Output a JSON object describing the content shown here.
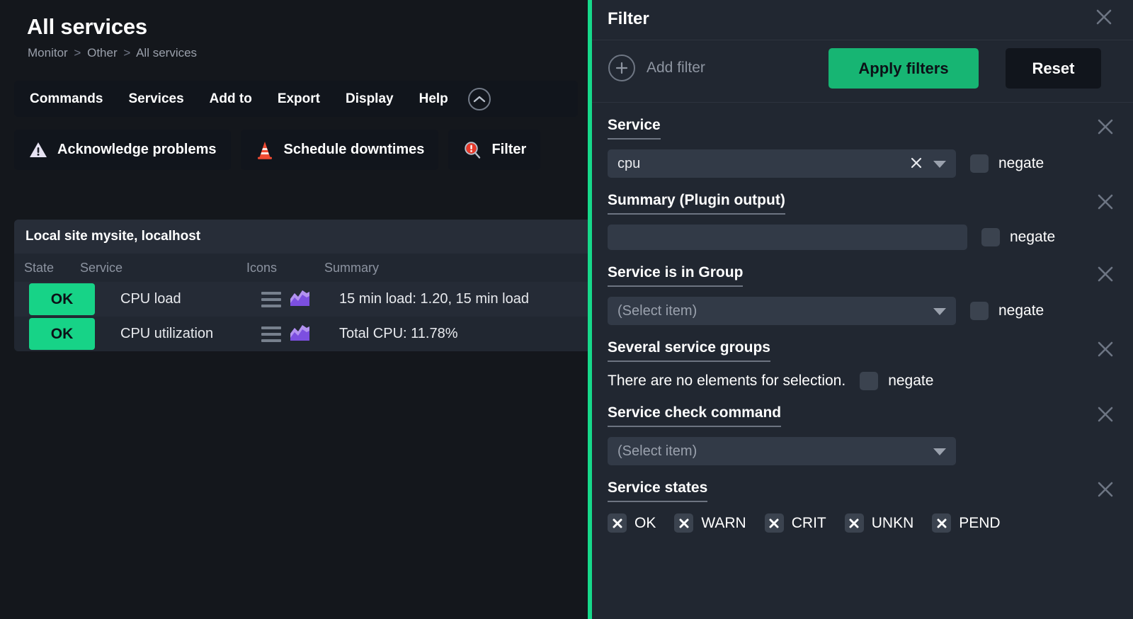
{
  "page": {
    "title": "All services",
    "breadcrumb": [
      "Monitor",
      "Other",
      "All services"
    ],
    "breadcrumb_separator": ">"
  },
  "menubar": {
    "items": [
      {
        "label": "Commands"
      },
      {
        "label": "Services"
      },
      {
        "label": "Add to"
      },
      {
        "label": "Export"
      },
      {
        "label": "Display"
      },
      {
        "label": "Help"
      }
    ],
    "collapse_icon": "chevron-up-icon"
  },
  "actions": [
    {
      "label": "Acknowledge problems",
      "icon": "warning-triangle-icon"
    },
    {
      "label": "Schedule downtimes",
      "icon": "traffic-cone-icon"
    },
    {
      "label": "Filter",
      "icon": "filter-search-alert-icon"
    }
  ],
  "table": {
    "title": "Local site mysite, localhost",
    "columns": [
      "State",
      "Service",
      "Icons",
      "Summary"
    ],
    "rows": [
      {
        "state": "OK",
        "service": "CPU load",
        "icons": [
          "menu-icon",
          "graph-icon"
        ],
        "summary": "15 min load: 1.20, 15 min load"
      },
      {
        "state": "OK",
        "service": "CPU utilization",
        "icons": [
          "menu-icon",
          "graph-icon"
        ],
        "summary": "Total CPU: 11.78%"
      }
    ]
  },
  "filter_panel": {
    "title": "Filter",
    "close_icon": "close-icon",
    "add_filter_label": "Add filter",
    "apply_label": "Apply filters",
    "reset_label": "Reset",
    "negate_label": "negate",
    "groups": [
      {
        "label": "Service",
        "control": "select",
        "value": "cpu",
        "has_clear": true,
        "negate": false
      },
      {
        "label": "Summary (Plugin output)",
        "control": "text",
        "value": "",
        "placeholder": "",
        "negate": false
      },
      {
        "label": "Service is in Group",
        "control": "select",
        "value": "",
        "placeholder": "(Select item)",
        "negate": false
      },
      {
        "label": "Several service groups",
        "control": "empty",
        "empty_text": "There are no elements for selection.",
        "negate": false
      },
      {
        "label": "Service check command",
        "control": "select",
        "value": "",
        "placeholder": "(Select item)",
        "negate": false
      },
      {
        "label": "Service states",
        "control": "states"
      }
    ],
    "service_states": [
      {
        "label": "OK",
        "checked": true
      },
      {
        "label": "WARN",
        "checked": true
      },
      {
        "label": "CRIT",
        "checked": true
      },
      {
        "label": "UNKN",
        "checked": true
      },
      {
        "label": "PEND",
        "checked": true
      }
    ]
  },
  "colors": {
    "accent_green": "#16d98a",
    "apply_green": "#17b573",
    "state_ok_green": "#17d387",
    "page_bg": "#14171c",
    "panel_bg": "#212731",
    "graph_icon_purple": "#8b5cf6"
  }
}
